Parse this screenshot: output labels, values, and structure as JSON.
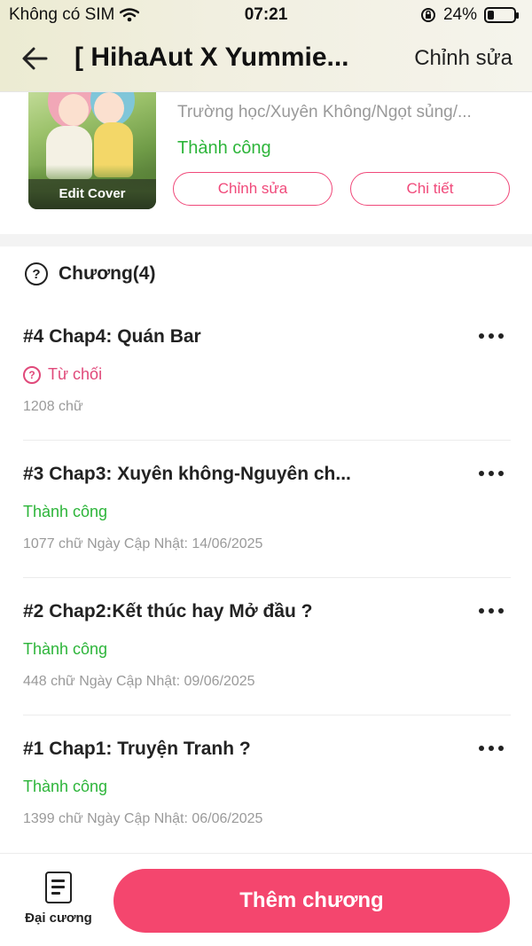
{
  "status_bar": {
    "carrier": "Không có SIM",
    "time": "07:21",
    "battery": "24%",
    "battery_level": 0.24
  },
  "header": {
    "title": "[ HihaAut X Yummie...",
    "edit_label": "Chỉnh sửa"
  },
  "book": {
    "cover_label": "Edit Cover",
    "tags": "Trường học/Xuyên Không/Ngọt sủng/...",
    "status": "Thành công",
    "edit_button": "Chỉnh sửa",
    "detail_button": "Chi tiết"
  },
  "chapters": {
    "heading": "Chương(4)",
    "items": [
      {
        "title": "#4 Chap4: Quán Bar",
        "status": "Từ chối",
        "meta": "1208 chữ"
      },
      {
        "title": "#3 Chap3: Xuyên không-Nguyên ch...",
        "status": "Thành công",
        "meta": "1077 chữ Ngày Cập Nhật: 14/06/2025"
      },
      {
        "title": "#2 Chap2:Kết thúc hay Mở đầu ?",
        "status": "Thành công",
        "meta": "448 chữ Ngày Cập Nhật: 09/06/2025"
      },
      {
        "title": "#1 Chap1: Truyện Tranh ?",
        "status": "Thành công",
        "meta": "1399 chữ Ngày Cập Nhật: 06/06/2025"
      }
    ]
  },
  "bottom": {
    "outline_label": "Đại cương",
    "add_chapter_label": "Thêm chương"
  },
  "colors": {
    "accent": "#f4466e",
    "success": "#2db53a",
    "reject": "#e0497a"
  }
}
